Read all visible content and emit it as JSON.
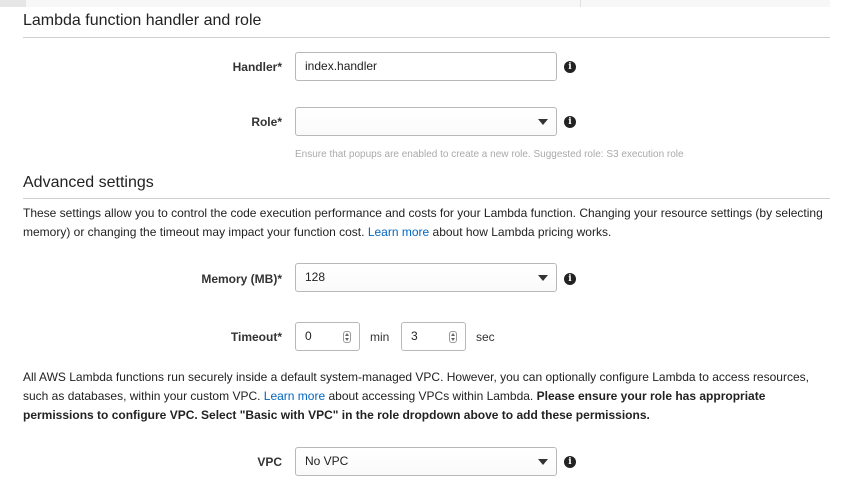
{
  "handler_section": {
    "title": "Lambda function handler and role",
    "handler_label": "Handler*",
    "handler_value": "index.handler",
    "role_label": "Role*",
    "role_value": "",
    "role_hint": "Ensure that popups are enabled to create a new role. Suggested role: S3 execution role"
  },
  "advanced_section": {
    "title": "Advanced settings",
    "desc_before_link": "These settings allow you to control the code execution performance and costs for your Lambda function. Changing your resource settings (by selecting memory) or changing the timeout may impact your function cost. ",
    "desc_link": "Learn more",
    "desc_after_link": " about how Lambda pricing works.",
    "memory_label": "Memory (MB)*",
    "memory_value": "128",
    "timeout_label": "Timeout*",
    "timeout_min_value": "0",
    "timeout_min_unit": "min",
    "timeout_sec_value": "3",
    "timeout_sec_unit": "sec",
    "vpc_text_1": "All AWS Lambda functions run securely inside a default system-managed VPC. However, you can optionally configure Lambda to access resources, such as databases, within your custom VPC. ",
    "vpc_link": "Learn more",
    "vpc_text_2": " about accessing VPCs within Lambda. ",
    "vpc_bold": "Please ensure your role has appropriate permissions to configure VPC. Select \"Basic with VPC\" in the role dropdown above to add these permissions.",
    "vpc_label": "VPC",
    "vpc_value": "No VPC"
  },
  "icons": {
    "info": "info-icon",
    "dropdown": "chevron-down-icon",
    "stepper": "stepper-icon"
  }
}
